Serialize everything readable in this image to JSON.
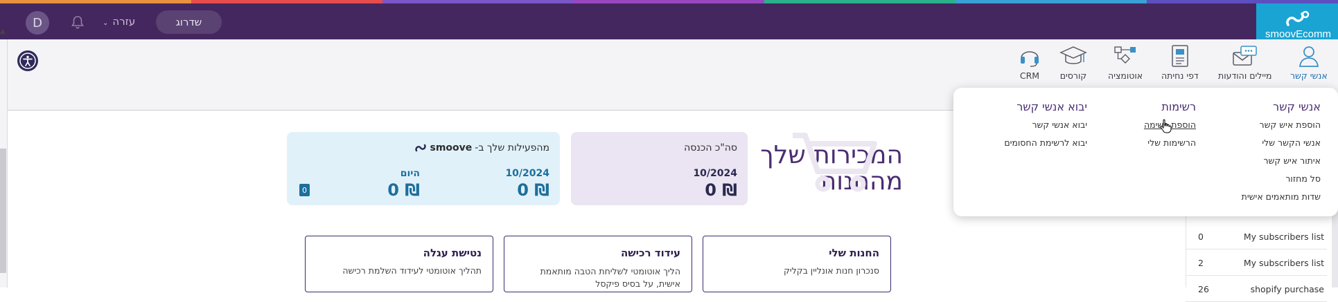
{
  "colors": {
    "topbar": "#45275f",
    "brand": "#1aa4d4",
    "accent_purple": "#4a2d72",
    "rainbow": [
      "#e8913f",
      "#e64c4c",
      "#7a56c8",
      "#9a48c2",
      "#2bb08a",
      "#3aa0d6",
      "#5d4fbf"
    ]
  },
  "topbar": {
    "logo": "smoovEcomm",
    "upgrade_label": "שדרוג",
    "help_label": "עזרה",
    "avatar_initial": "D"
  },
  "nav": {
    "items": [
      {
        "label": "אנשי קשר",
        "icon": "contact-person-icon"
      },
      {
        "label": "מיילים והודעות",
        "icon": "email-messages-icon"
      },
      {
        "label": "דפי נחיתה",
        "icon": "landing-page-icon"
      },
      {
        "label": "אוטומציה",
        "icon": "automation-icon"
      },
      {
        "label": "קורסים",
        "icon": "graduation-cap-icon"
      },
      {
        "label": "CRM",
        "icon": "headset-icon"
      }
    ]
  },
  "main": {
    "title_line1": "המכירות שלך",
    "title_line2": "מהחנות",
    "income_card": {
      "title": "סה\"כ הכנסה",
      "date": "10/2024",
      "amount": "0 ₪"
    },
    "activity_card": {
      "title_prefix": "מהפעילות שלך ב-",
      "brand": "smoove",
      "month_date": "10/2024",
      "month_amount": "0 ₪",
      "today_label": "היום",
      "today_amount": "0 ₪",
      "today_badge": "0"
    },
    "tiles": [
      {
        "title": "החנות שלי",
        "desc": "סנכרון חנות אונליין בקליק"
      },
      {
        "title": "עידוד רכישה",
        "desc": "הליך אוטומטי לשליחת הטבה מותאמת אישית, על בסיס פיקסל"
      },
      {
        "title": "נטישת עגלה",
        "desc": "תהליך אוטומטי לעידוד השלמת רכישה"
      }
    ]
  },
  "lists": {
    "rows": [
      {
        "name": "My subscribers list",
        "count": "0"
      },
      {
        "name": "My subscribers list",
        "count": "2"
      },
      {
        "name": "shopify purchase",
        "count": "26"
      }
    ]
  },
  "dropdown": {
    "col_contacts": {
      "title": "אנשי קשר",
      "items": [
        "הוספת איש קשר",
        "אנשי הקשר שלי",
        "איתור איש קשר",
        "סל מחזור",
        "שדות מותאמים אישית"
      ]
    },
    "col_lists": {
      "title": "רשימות",
      "items": [
        "הוספת רשימה",
        "הרשימות שלי"
      ]
    },
    "col_import": {
      "title": "יבוא אנשי קשר",
      "items": [
        "יבוא אנשי קשר",
        "יבוא לרשימת החסומים"
      ]
    }
  }
}
